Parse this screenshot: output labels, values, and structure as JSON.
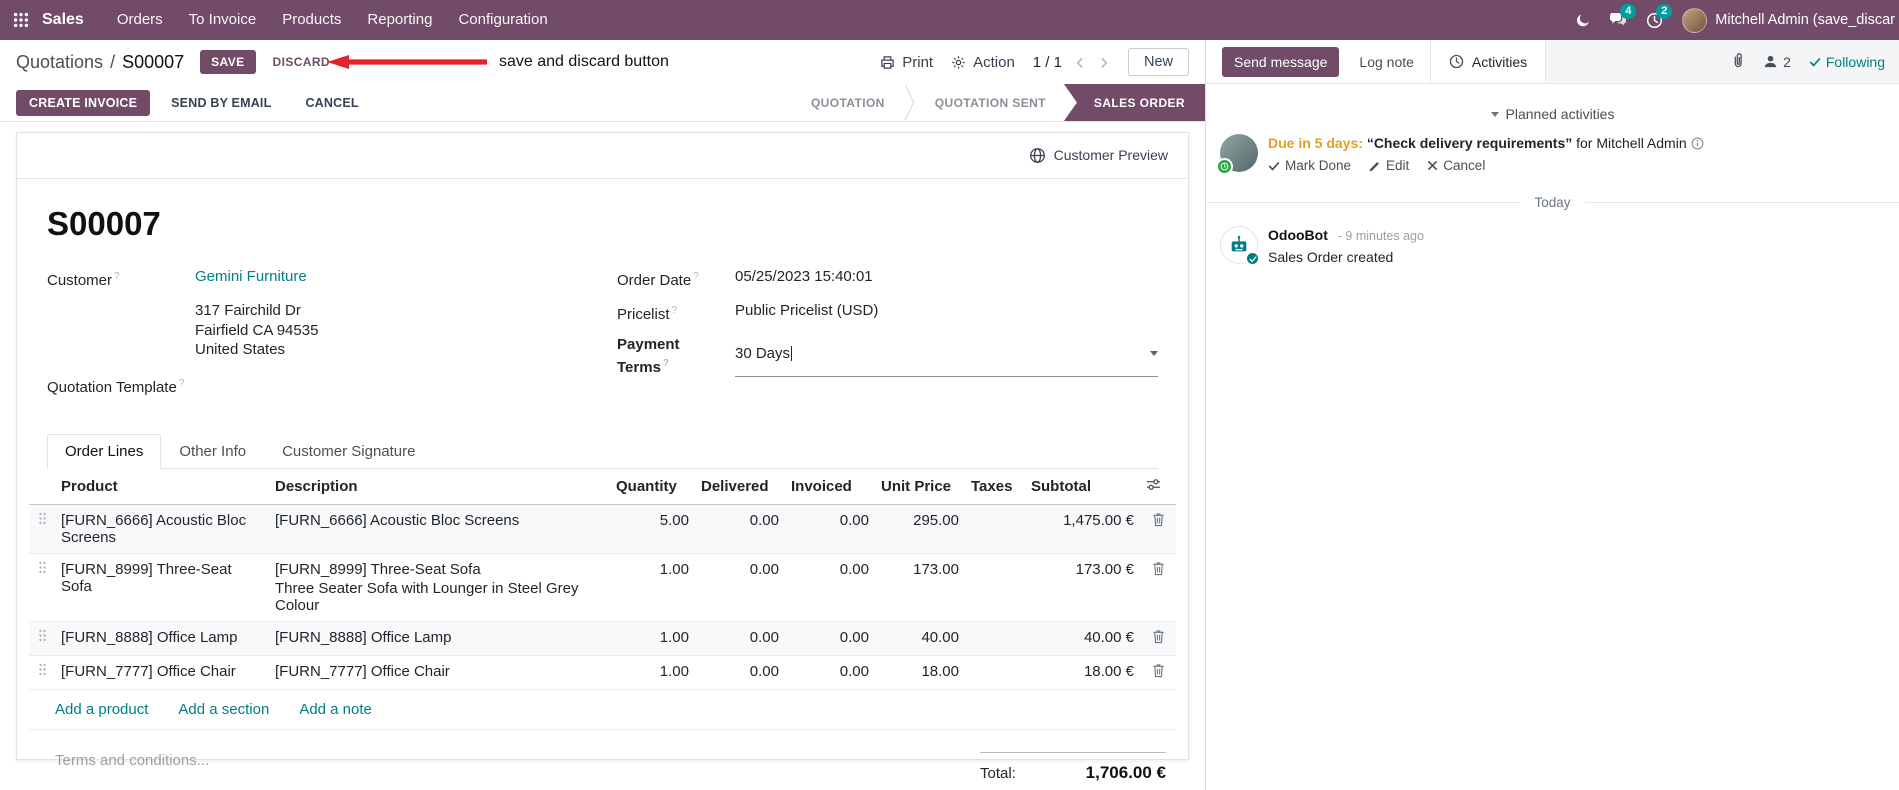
{
  "colors": {
    "brand_purple": "#714B67",
    "link_teal": "#017E84",
    "highlight_blue": "#2b6fe3",
    "annotation_red": "#e4222a",
    "warning_orange": "#e0a028",
    "badge_teal": "#00A09D"
  },
  "navbar": {
    "brand": "Sales",
    "menus": [
      "Orders",
      "To Invoice",
      "Products",
      "Reporting",
      "Configuration"
    ],
    "messages_badge": "4",
    "activities_badge": "2",
    "user_name": "Mitchell Admin (save_discar"
  },
  "control_panel": {
    "breadcrumb_parent": "Quotations",
    "breadcrumb_sep": "/",
    "breadcrumb_current": "S00007",
    "save": "SAVE",
    "discard": "DISCARD",
    "print": "Print",
    "action": "Action",
    "pager": "1 / 1",
    "pager_prev": "‹",
    "pager_next": "›",
    "new": "New"
  },
  "annotation": {
    "text": "save and discard button"
  },
  "status_row": {
    "buttons": [
      "CREATE INVOICE",
      "SEND BY EMAIL",
      "CANCEL"
    ],
    "steps": [
      {
        "label": "QUOTATION"
      },
      {
        "label": "QUOTATION SENT"
      },
      {
        "label": "SALES ORDER",
        "active": true
      }
    ]
  },
  "form": {
    "customer_preview": "Customer Preview",
    "title": "S00007",
    "hint": "?",
    "customer_label": "Customer",
    "customer_value": "Gemini Furniture",
    "address_line1": "317 Fairchild Dr",
    "address_line2": "Fairfield CA 94535",
    "address_line3": "United States",
    "quotation_template_label": "Quotation Template",
    "order_date_label": "Order Date",
    "order_date_value": "05/25/2023 15:40:01",
    "pricelist_label": "Pricelist",
    "pricelist_value": "Public Pricelist (USD)",
    "payment_terms_label": "Payment Terms",
    "payment_terms_value": "30 Days"
  },
  "tabs": [
    {
      "label": "Order Lines"
    },
    {
      "label": "Other Info"
    },
    {
      "label": "Customer Signature"
    }
  ],
  "order_lines": {
    "headers": {
      "product": "Product",
      "description": "Description",
      "quantity": "Quantity",
      "delivered": "Delivered",
      "invoiced": "Invoiced",
      "unit_price": "Unit Price",
      "taxes": "Taxes",
      "subtotal": "Subtotal"
    },
    "rows": [
      {
        "product": "[FURN_6666] Acoustic Bloc Screens",
        "description": "[FURN_6666] Acoustic Bloc Screens",
        "description_extra": "",
        "quantity": "5.00",
        "delivered": "0.00",
        "invoiced": "0.00",
        "unit_price": "295.00",
        "taxes": "",
        "subtotal": "1,475.00 €"
      },
      {
        "product": "[FURN_8999] Three-Seat Sofa",
        "description": "[FURN_8999] Three-Seat Sofa",
        "description_extra": "Three Seater Sofa with Lounger in Steel Grey Colour",
        "quantity": "1.00",
        "delivered": "0.00",
        "invoiced": "0.00",
        "unit_price": "173.00",
        "taxes": "",
        "subtotal": "173.00 €"
      },
      {
        "product": "[FURN_8888] Office Lamp",
        "description": "[FURN_8888] Office Lamp",
        "description_extra": "",
        "quantity": "1.00",
        "delivered": "0.00",
        "invoiced": "0.00",
        "unit_price": "40.00",
        "taxes": "",
        "subtotal": "40.00 €"
      },
      {
        "product": "[FURN_7777] Office Chair",
        "description": "[FURN_7777] Office Chair",
        "description_extra": "",
        "quantity": "1.00",
        "delivered": "0.00",
        "invoiced": "0.00",
        "unit_price": "18.00",
        "taxes": "",
        "subtotal": "18.00 €"
      }
    ],
    "links": [
      "Add a product",
      "Add a section",
      "Add a note"
    ],
    "terms_placeholder": "Terms and conditions...",
    "total_label": "Total:",
    "total_value": "1,706.00 €"
  },
  "chatter": {
    "send_message": "Send message",
    "log_note": "Log note",
    "activities": "Activities",
    "followers_count": "2",
    "following": "Following",
    "planned_title": "Planned activities",
    "activity": {
      "due": "Due in 5 days:",
      "summary": "“Check delivery requirements”",
      "assignee": "for Mitchell Admin",
      "mark_done": "Mark Done",
      "edit": "Edit",
      "cancel": "Cancel"
    },
    "today": "Today",
    "message": {
      "author": "OdooBot",
      "time": "- 9 minutes ago",
      "body": "Sales Order created"
    }
  }
}
